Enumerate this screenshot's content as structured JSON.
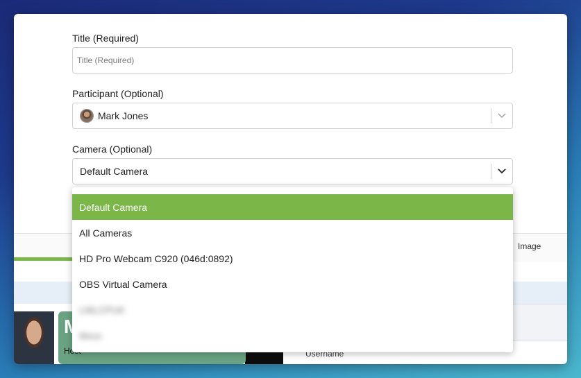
{
  "form": {
    "title_label": "Title (Required)",
    "title_placeholder": "Title (Required)",
    "participant_label": "Participant (Optional)",
    "participant_value": "Mark Jones",
    "camera_label": "Camera (Optional)",
    "camera_value": "Default Camera"
  },
  "camera_dropdown": {
    "options": [
      {
        "label": "Default Camera",
        "selected": true
      },
      {
        "label": "All Cameras"
      },
      {
        "label": "HD Pro Webcam C920 (046d:0892)"
      },
      {
        "label": "OBS Virtual Camera"
      },
      {
        "label": "LMLCPUK"
      },
      {
        "label": "Mxxx"
      }
    ]
  },
  "background": {
    "tab_image": "Image",
    "host_initial": "M",
    "host_label": "Host",
    "username_label": "Username"
  },
  "colors": {
    "accent": "#7ab648",
    "host_tile": "#6aa383"
  },
  "icons": {
    "participant_avatar": "avatar",
    "select_chevron": "chevron-down-icon"
  }
}
